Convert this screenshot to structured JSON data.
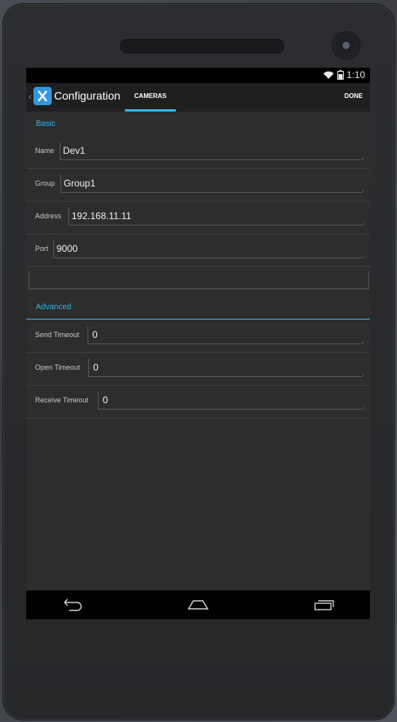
{
  "status": {
    "time": "1:10"
  },
  "actionbar": {
    "title": "Configuration",
    "tab_label": "CAMERAS",
    "done_label": "DONE"
  },
  "sections": {
    "basic": "Basic",
    "advanced": "Advanced"
  },
  "basic_fields": [
    {
      "label": "Name",
      "value": "Dev1"
    },
    {
      "label": "Group",
      "value": "Group1"
    },
    {
      "label": "Address",
      "value": "192.168.11.11"
    },
    {
      "label": "Port",
      "value": "9000"
    }
  ],
  "advanced_fields": [
    {
      "label": "Send Timeout",
      "value": "0"
    },
    {
      "label": "Open Timeout",
      "value": "0"
    },
    {
      "label": "Receive Timeout",
      "value": "0"
    }
  ],
  "colors": {
    "accent": "#33b5e5",
    "background": "#2d2d2d",
    "actionbar": "#1f1f1f"
  },
  "icons": [
    "wifi-icon",
    "battery-icon",
    "back-icon",
    "home-icon",
    "recents-icon",
    "app-icon"
  ]
}
